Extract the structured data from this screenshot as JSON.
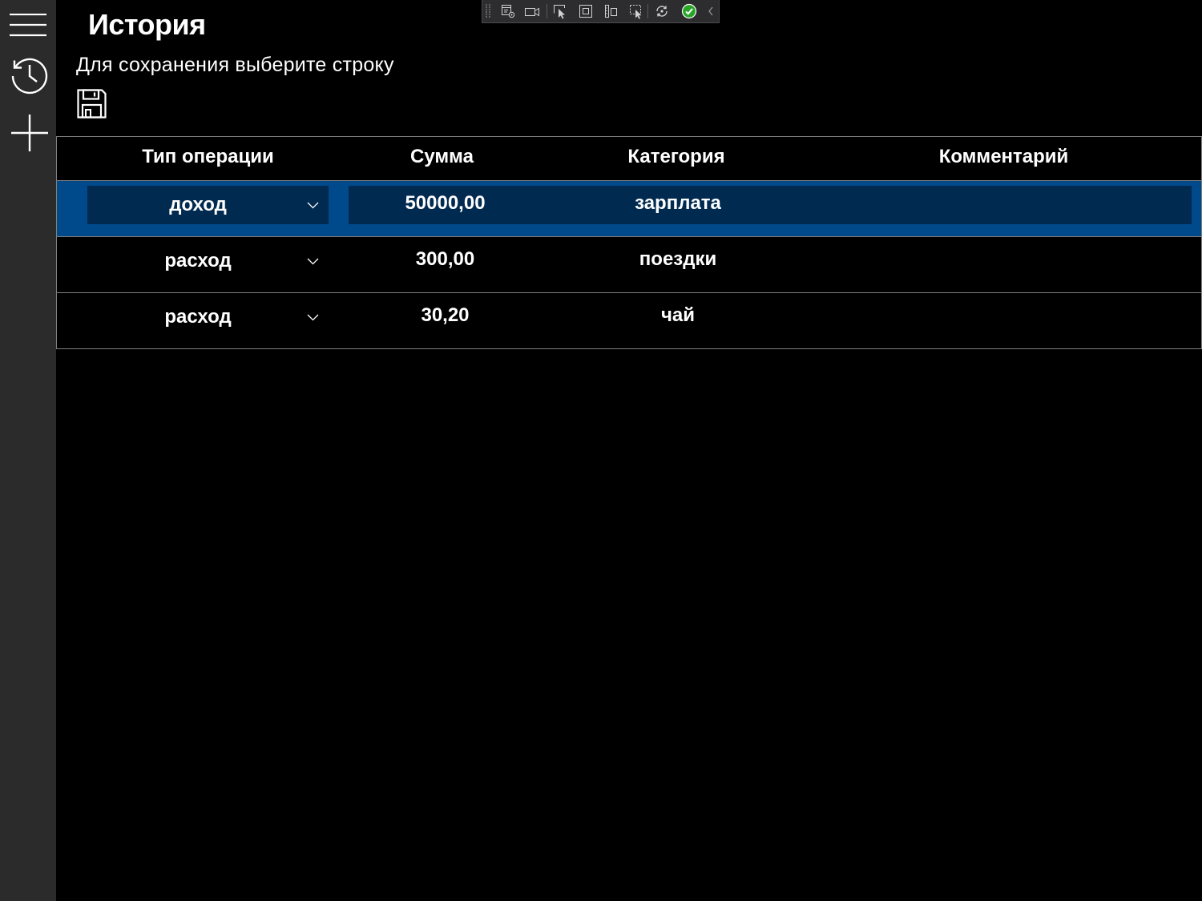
{
  "app": {
    "title": "История",
    "hint": "Для сохранения выберите строку"
  },
  "sidebar": {
    "menu_icon": "hamburger-menu-icon",
    "items": [
      {
        "icon": "history-icon"
      },
      {
        "icon": "add-icon"
      }
    ]
  },
  "save_button": {
    "icon": "save-icon"
  },
  "debug_toolbar": {
    "icons": [
      "toolbar-grip-icon",
      "live-visual-tree-icon",
      "camera-icon",
      "select-element-icon",
      "layout-adorners-icon",
      "track-focus-icon",
      "preview-selection-icon",
      "hot-reload-icon",
      "status-ok-check-icon",
      "collapse-chevron-icon"
    ]
  },
  "history": {
    "columns": [
      "Тип операции",
      "Сумма",
      "Категория",
      "Комментарий"
    ],
    "selected_row_index": 0,
    "rows": [
      {
        "type": "доход",
        "amount": "50000,00",
        "category": "зарплата",
        "comment": ""
      },
      {
        "type": "расход",
        "amount": "300,00",
        "category": "поездки",
        "comment": ""
      },
      {
        "type": "расход",
        "amount": "30,20",
        "category": "чай",
        "comment": ""
      }
    ]
  },
  "colors": {
    "background": "#000000",
    "sidebar": "#2b2b2b",
    "text": "#ffffff",
    "grid_line": "#808080",
    "selected_row": "#004a8c",
    "selected_cell": "#012a50",
    "status_ok": "#2aa52a"
  }
}
